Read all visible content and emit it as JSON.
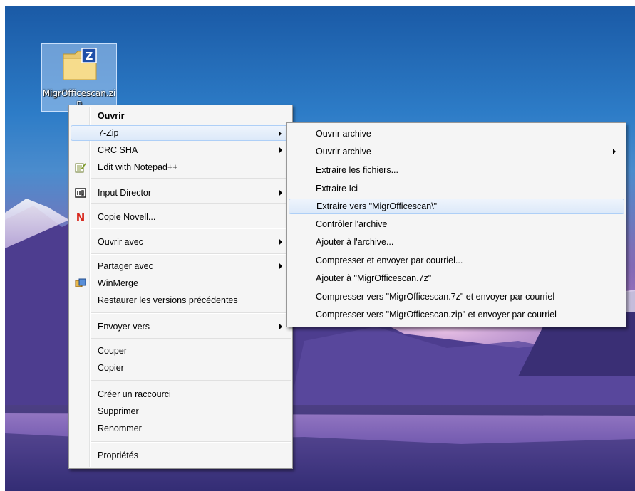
{
  "desktop_icon": {
    "label": "MigrOfficescan.zip"
  },
  "context_menu": {
    "items": [
      {
        "label": "Ouvrir"
      },
      {
        "label": "7-Zip"
      },
      {
        "label": "CRC SHA"
      },
      {
        "label": "Edit with Notepad++"
      },
      {
        "label": "Input Director"
      },
      {
        "label": "Copie Novell..."
      },
      {
        "label": "Ouvrir avec"
      },
      {
        "label": "Partager avec"
      },
      {
        "label": "WinMerge"
      },
      {
        "label": "Restaurer les versions précédentes"
      },
      {
        "label": "Envoyer vers"
      },
      {
        "label": "Couper"
      },
      {
        "label": "Copier"
      },
      {
        "label": "Créer un raccourci"
      },
      {
        "label": "Supprimer"
      },
      {
        "label": "Renommer"
      },
      {
        "label": "Propriétés"
      }
    ]
  },
  "submenu_7zip": {
    "items": [
      {
        "label": "Ouvrir archive"
      },
      {
        "label": "Ouvrir archive"
      },
      {
        "label": "Extraire les fichiers..."
      },
      {
        "label": "Extraire Ici"
      },
      {
        "label": "Extraire vers \"MigrOfficescan\\\""
      },
      {
        "label": "Contrôler l'archive"
      },
      {
        "label": "Ajouter à l'archive..."
      },
      {
        "label": "Compresser et envoyer par courriel..."
      },
      {
        "label": "Ajouter à \"MigrOfficescan.7z\""
      },
      {
        "label": "Compresser vers \"MigrOfficescan.7z\" et envoyer par courriel"
      },
      {
        "label": "Compresser vers \"MigrOfficescan.zip\" et envoyer par courriel"
      }
    ]
  },
  "colors": {
    "highlight": "#dce9f9",
    "highlight_border": "#aecff7",
    "menu_bg": "#f5f5f5"
  }
}
